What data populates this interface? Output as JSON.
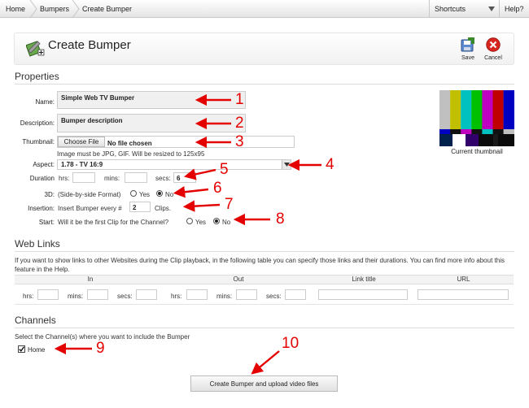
{
  "topbar": {
    "crumbs": [
      "Home",
      "Bumpers",
      "Create Bumper"
    ],
    "shortcuts": "Shortcuts",
    "help": "Help?"
  },
  "header": {
    "title": "Create Bumper",
    "save": "Save",
    "cancel": "Cancel"
  },
  "properties": {
    "heading": "Properties",
    "name_label": "Name:",
    "name_value": "Simple Web TV Bumper",
    "description_label": "Description:",
    "description_value": "Bumper description",
    "thumbnail_label": "Thumbnail:",
    "choose_file": "Choose File",
    "no_file": "No file chosen",
    "thumb_hint": "Image must be JPG, GIF. Will be resized to 125x95",
    "current_thumbnail": "Current thumbnail",
    "aspect_label": "Aspect:",
    "aspect_value": "1.78 - TV 16:9",
    "duration_label": "Duration",
    "hrs": "hrs:",
    "mins": "mins:",
    "secs": "secs:",
    "secs_value": "6",
    "threed_label": "3D:",
    "threed_hint": "(Side-by-side Format)",
    "yes": "Yes",
    "no": "No",
    "insertion_label": "Insertion:",
    "insertion_pre": "Insert Bumper every #",
    "insertion_value": "2",
    "insertion_post": "Clips.",
    "start_label": "Start:",
    "start_question": "Will it be the first Clip for the Channel?"
  },
  "weblinks": {
    "heading": "Web Links",
    "description": "If you want to show links to other Websites during the Clip playback, in the following table you can specify those links and their durations. You can find more info about this feature in the Help.",
    "columns": [
      "In",
      "Out",
      "Link title",
      "URL"
    ],
    "hrs": "hrs:",
    "mins": "mins:",
    "secs": "secs:"
  },
  "channels": {
    "heading": "Channels",
    "description": "Select the Channel(s) where you want to include the Bumper",
    "home": "Home",
    "submit": "Create Bumper and upload video files"
  },
  "annotations": [
    "1",
    "2",
    "3",
    "4",
    "5",
    "6",
    "7",
    "8",
    "9",
    "10"
  ],
  "colors": {
    "arrow": "#e40000",
    "save_icon": "#3a8a2a",
    "cancel_icon": "#d8261e"
  },
  "icons": {
    "header_icon": "bumper-tools-icon",
    "save_icon": "save-disk-icon",
    "cancel_icon": "cancel-x-icon"
  }
}
